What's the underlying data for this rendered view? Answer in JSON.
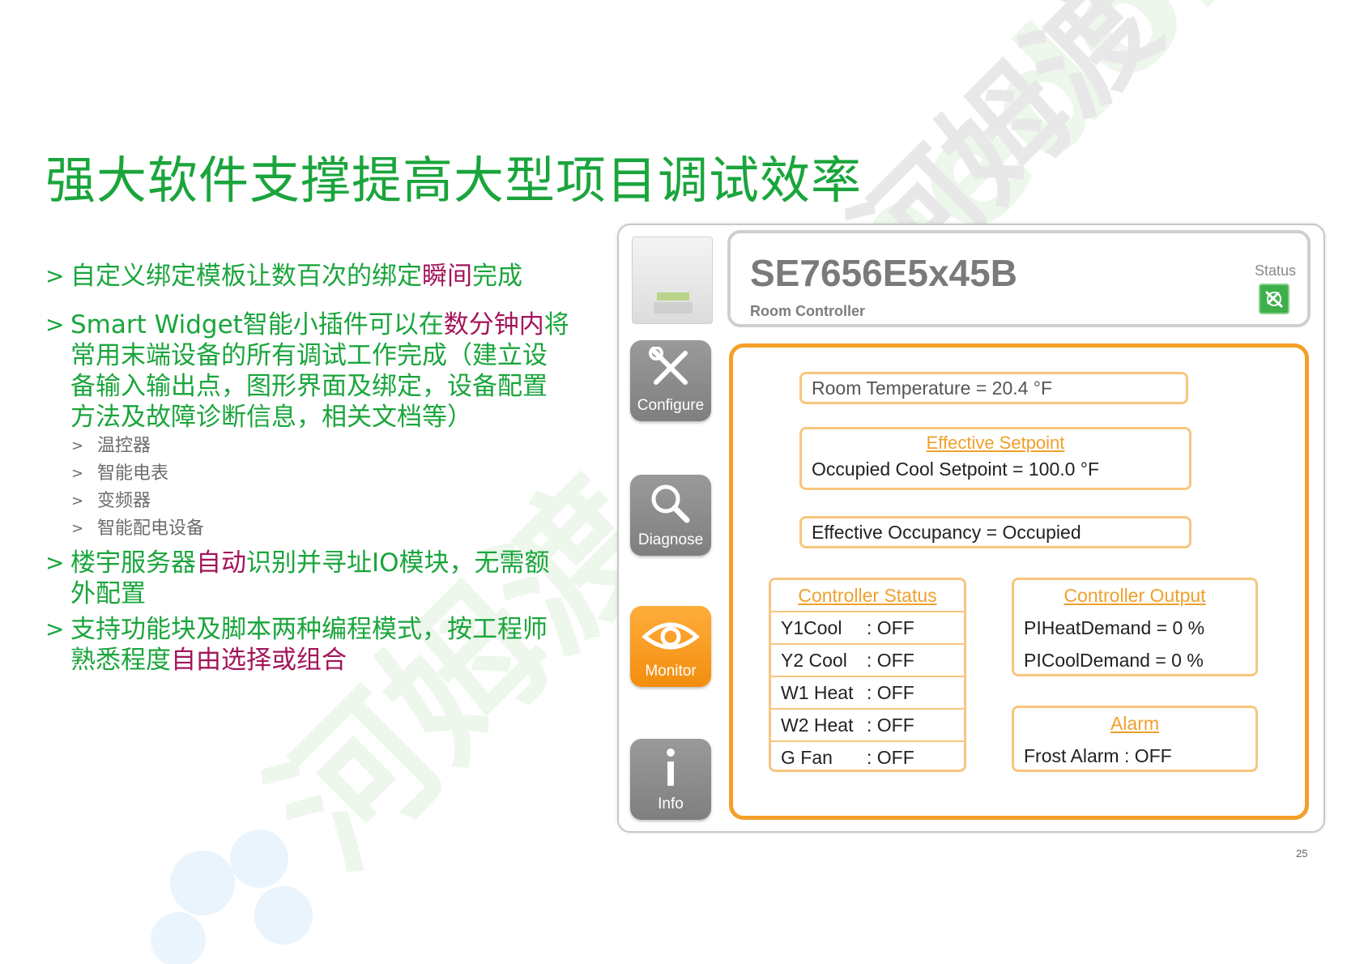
{
  "slide": {
    "title": "强大软件支撑提高大型项目调试效率",
    "page_number": "25",
    "watermark_text": "河姆渡 homedo.com"
  },
  "bullets": [
    {
      "marker": ">",
      "parts": [
        "自定义绑定模板让数百次的绑定",
        "瞬间",
        "完成"
      ]
    },
    {
      "marker": ">",
      "parts": [
        "Smart Widget智能小插件可以在",
        "数分钟内",
        "将常用末端设备的所有调试工作完成（建立设备输入输出点，图形界面及绑定，设备配置方法及故障诊断信息，相关文档等）"
      ],
      "sub": [
        "温控器",
        "智能电表",
        "变频器",
        "智能配电设备"
      ]
    },
    {
      "marker": ">",
      "parts": [
        "楼宇服务器",
        "自动",
        "识别并寻址IO模块，无需额外配置"
      ]
    },
    {
      "marker": ">",
      "parts": [
        "支持功能块及脚本两种编程模式，按工程师熟悉程度",
        "自由选择或组合",
        ""
      ]
    }
  ],
  "device": {
    "model": "SE7656E5x45B",
    "type": "Room Controller",
    "status_label": "Status",
    "nav": [
      "Configure",
      "Diagnose",
      "Monitor",
      "Info"
    ],
    "active_nav": "Monitor",
    "room_temp": "Room Temperature = 20.4 °F",
    "setpoint_title": "Effective Setpoint",
    "setpoint_value": "Occupied Cool Setpoint = 100.0 °F",
    "occupancy": "Effective Occupancy = Occupied",
    "controller_status": {
      "title": "Controller Status",
      "rows": [
        {
          "key": "Y1Cool",
          "value": ": OFF"
        },
        {
          "key": "Y2 Cool",
          "value": ": OFF"
        },
        {
          "key": "W1 Heat",
          "value": ": OFF"
        },
        {
          "key": "W2 Heat",
          "value": ": OFF"
        },
        {
          "key": "G Fan",
          "value": ": OFF"
        }
      ]
    },
    "controller_output": {
      "title": "Controller Output",
      "rows": [
        "PIHeatDemand = 0 %",
        "PICoolDemand = 0 %"
      ]
    },
    "alarm": {
      "title": "Alarm",
      "rows": [
        "Frost Alarm : OFF"
      ]
    }
  },
  "colors": {
    "title_green": "#1aa53c",
    "highlight": "#a3155a",
    "accent_orange": "#f4a028"
  }
}
